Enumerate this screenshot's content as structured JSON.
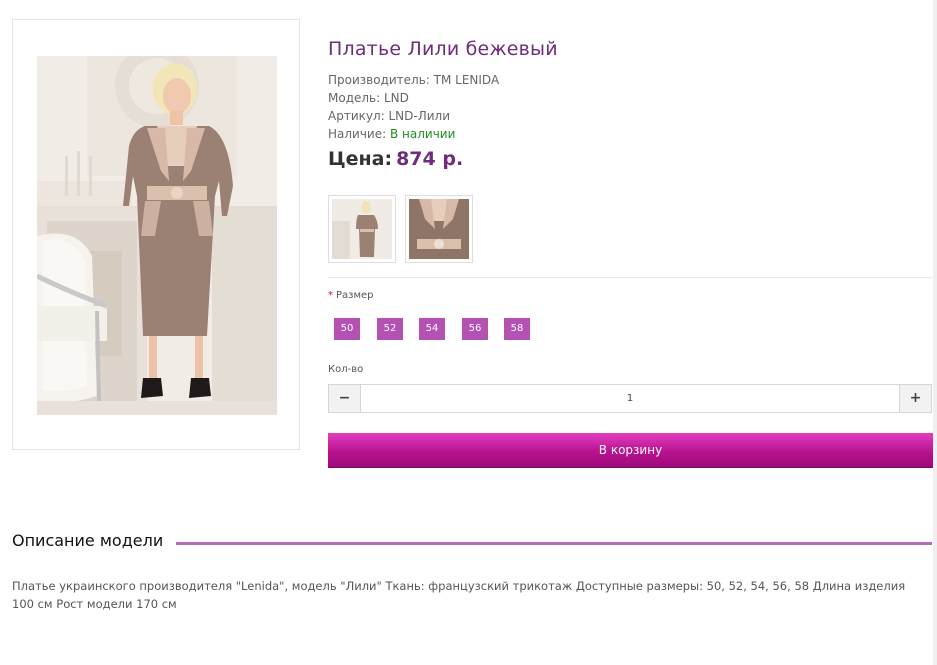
{
  "product": {
    "title": "Платье Лили бежевый",
    "manufacturer": "Производитель: TM LENIDA",
    "model": "Модель: LND",
    "sku": "Артикул: LND-Лили",
    "availability_label": "Наличие: ",
    "availability_value": "В наличии",
    "price_label": "Цена:",
    "price_value": "874 р."
  },
  "options": {
    "required_mark": "*",
    "size_label": "Размер",
    "sizes": [
      "50",
      "52",
      "54",
      "56",
      "58"
    ]
  },
  "quantity": {
    "label": "Кол-во",
    "value": "1",
    "minus_icon": "minus-icon",
    "plus_icon": "plus-icon"
  },
  "cart": {
    "button_label": "В корзину"
  },
  "description": {
    "title": "Описание модели",
    "text": "Платье украинского производителя \"Lenida\", модель \"Лили\" Ткань: французский трикотаж Доступные размеры: 50, 52, 54, 56, 58 Длина изделия 100 см Рост модели 170 см"
  },
  "colors": {
    "accent": "#6f2c7a",
    "size_button": "#b452b4",
    "cart_button": "#b8128f",
    "in_stock": "#1e8f1e",
    "divider_line": "#b86bb8"
  }
}
